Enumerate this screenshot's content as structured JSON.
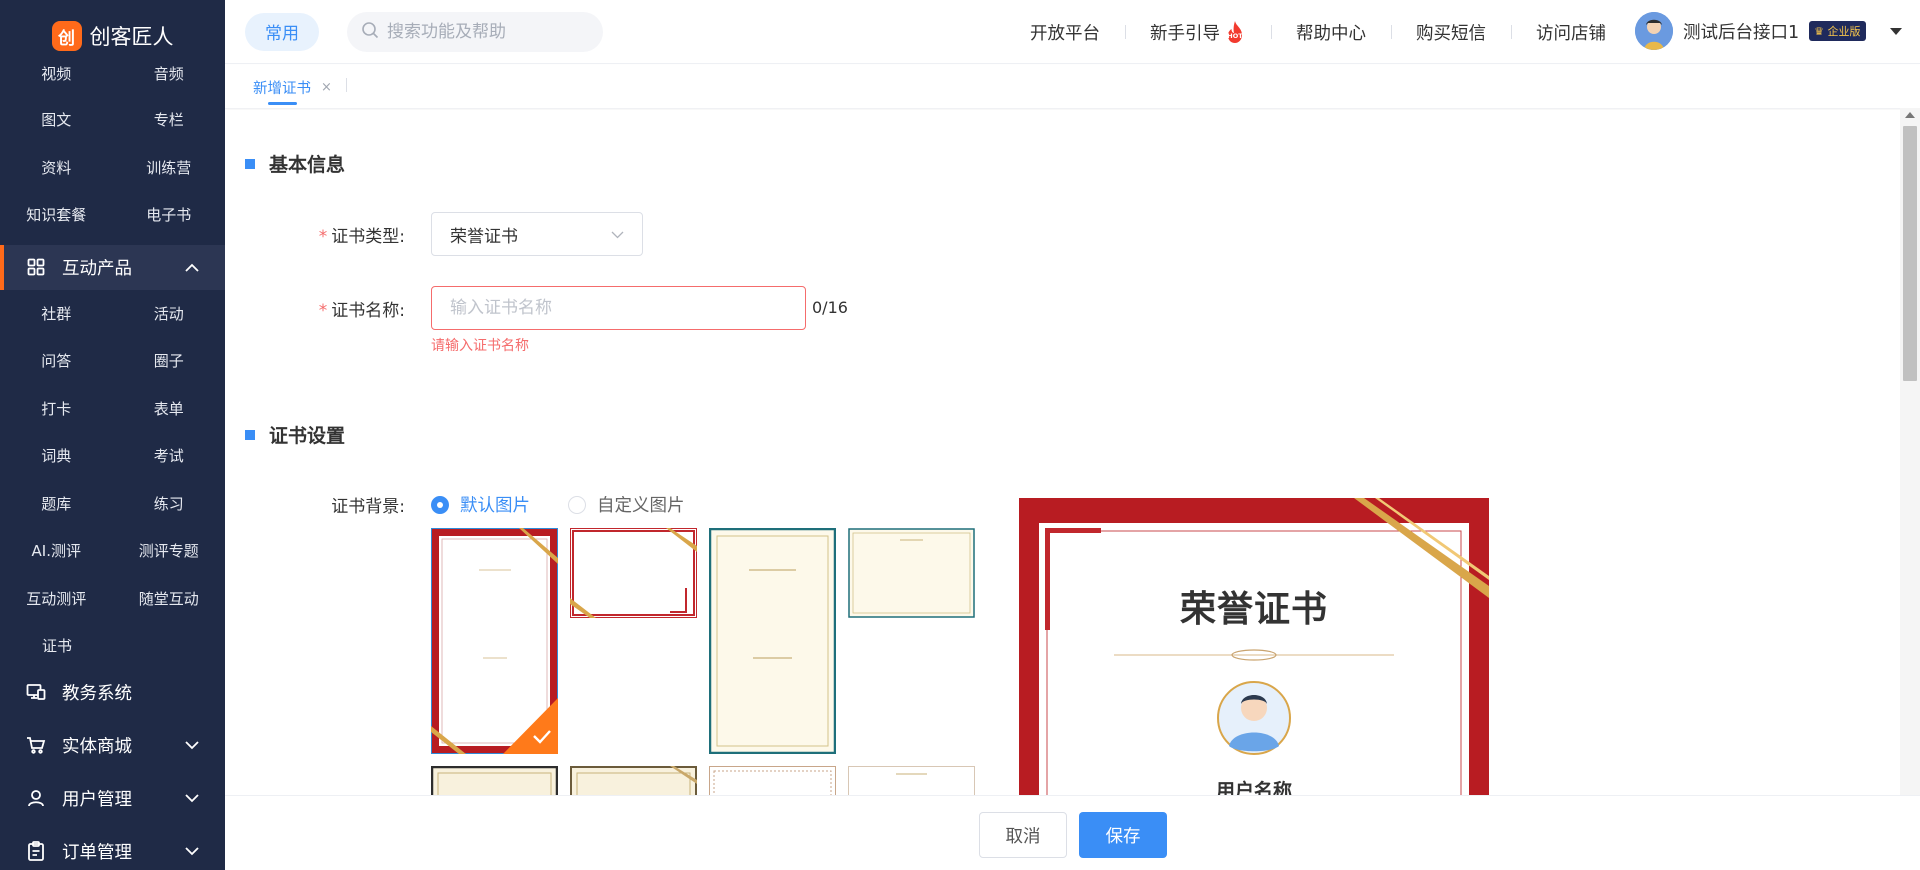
{
  "brand": {
    "logo_glyph": "创",
    "name": "创客匠人",
    "accent": "#ff6a1a"
  },
  "sidebar": {
    "top_items": [
      "视频",
      "音频",
      "图文",
      "专栏",
      "资料",
      "训练营",
      "知识套餐",
      "电子书"
    ],
    "active_group": "互动产品",
    "interactive_items": [
      "社群",
      "活动",
      "问答",
      "圈子",
      "打卡",
      "表单",
      "词典",
      "考试",
      "题库",
      "练习",
      "AI.测评",
      "测评专题",
      "互动测评",
      "随堂互动"
    ],
    "single_item": "证书",
    "groups": [
      "教务系统",
      "实体商城",
      "用户管理",
      "订单管理"
    ]
  },
  "topbar": {
    "common": "常用",
    "search_placeholder": "搜索功能及帮助",
    "links": [
      "开放平台",
      "新手引导",
      "帮助中心",
      "购买短信",
      "访问店铺"
    ],
    "hot_label": "HOT",
    "user_name": "测试后台接口1",
    "edition": "企业版"
  },
  "tabs": {
    "active": "新增证书",
    "close": "×"
  },
  "form": {
    "section_basic": "基本信息",
    "type_label": "证书类型:",
    "type_value": "荣誉证书",
    "name_label": "证书名称:",
    "name_placeholder": "输入证书名称",
    "name_counter": "0/16",
    "name_error": "请输入证书名称",
    "required_mark": "*",
    "section_settings": "证书设置",
    "bg_label": "证书背景:",
    "bg_default": "默认图片",
    "bg_custom": "自定义图片"
  },
  "preview": {
    "title": "荣誉证书",
    "user_label": "用户名称"
  },
  "footer": {
    "cancel": "取消",
    "save": "保存"
  },
  "colors": {
    "primary": "#3a8ef6",
    "error": "#f56c6c",
    "sidebar_bg": "#1f2a46",
    "cert_red": "#b81c22"
  }
}
